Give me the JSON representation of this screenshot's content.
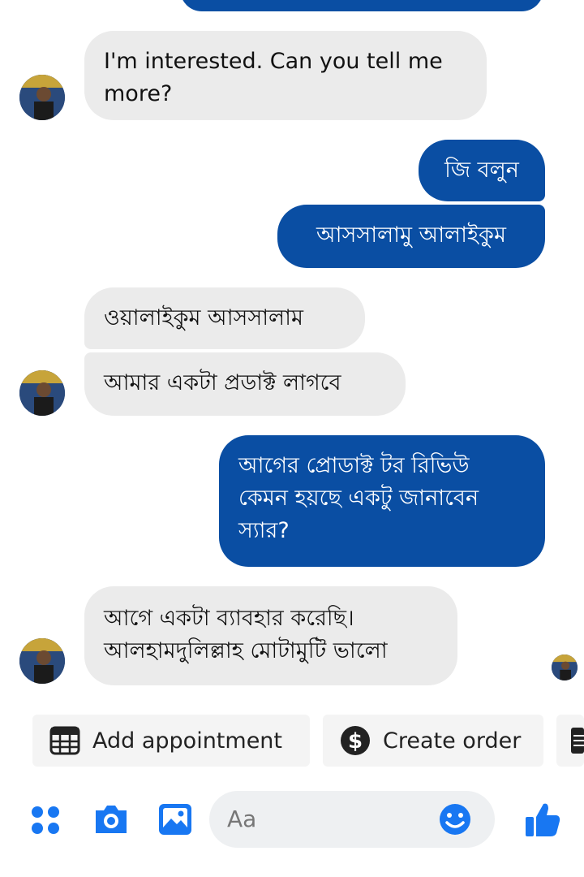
{
  "messages": [
    {
      "side": "incoming",
      "text": "I'm interested. Can you tell me more?"
    },
    {
      "side": "outgoing",
      "text": "জি বলুন"
    },
    {
      "side": "outgoing",
      "text": "আসসালামু আলাইকুম"
    },
    {
      "side": "incoming",
      "text": "ওয়ালাইকুম আসসালাম"
    },
    {
      "side": "incoming",
      "text": "আমার একটা প্রডাক্ট লাগবে"
    },
    {
      "side": "outgoing",
      "text": "আগের প্রোডাক্ট টর রিভিউ কেমন হয়ছে একটু জানাবেন স্যার?"
    },
    {
      "side": "incoming",
      "text": "আগে একটা ব্যাবহার করেছি। আলহামদুলিল্লাহ মোটামুটি ভালো"
    }
  ],
  "quick_replies": [
    {
      "label": "Add appointment",
      "icon": "calendar-icon"
    },
    {
      "label": "Create order",
      "icon": "dollar-icon"
    }
  ],
  "composer": {
    "placeholder": "Aa",
    "icons": [
      "menu-dots-icon",
      "camera-icon",
      "gallery-icon",
      "emoji-icon",
      "thumbs-up-icon"
    ]
  },
  "colors": {
    "outgoing_bubble": "#0a4ea3",
    "incoming_bubble": "#ebebeb",
    "accent": "#1877f2"
  }
}
